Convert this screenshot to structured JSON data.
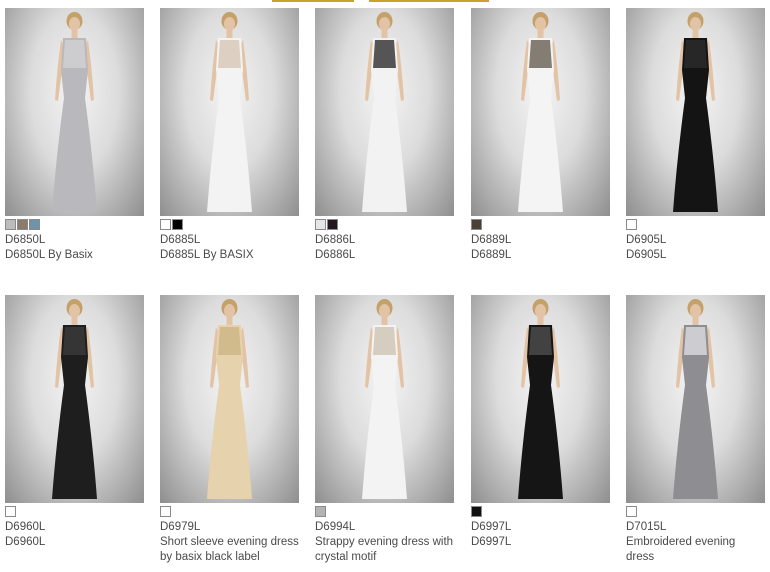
{
  "products": [
    {
      "code": "D6850L",
      "name": "D6850L By Basix",
      "swatches": [
        "#bcbcbc",
        "#8b7b6b",
        "#6f93a8"
      ],
      "dress": "#b9b9bd",
      "accent": "#d0d0d4"
    },
    {
      "code": "D6885L",
      "name": "D6885L By BASIX",
      "swatches": [
        "#ffffff",
        "#000000"
      ],
      "dress": "#f3f3f3",
      "accent": "#d8c9b8"
    },
    {
      "code": "D6886L",
      "name": "D6886L",
      "swatches": [
        "#e6e6e6",
        "#241820"
      ],
      "dress": "#f2f2f2",
      "accent": "#3a3a3a"
    },
    {
      "code": "D6889L",
      "name": "D6889L",
      "swatches": [
        "#4a4036"
      ],
      "dress": "#f4f4f4",
      "accent": "#6e675c"
    },
    {
      "code": "D6905L",
      "name": "D6905L",
      "swatches": [
        "#ffffff"
      ],
      "dress": "#141414",
      "accent": "#2a2a2a"
    },
    {
      "code": "D6960L",
      "name": "D6960L",
      "swatches": [
        "#ffffff"
      ],
      "dress": "#1e1e1e",
      "accent": "#3a3a3a"
    },
    {
      "code": "D6979L",
      "name": "Short sleeve evening dress by basix black label",
      "swatches": [
        "#ffffff"
      ],
      "dress": "#e6d3ad",
      "accent": "#cdb585"
    },
    {
      "code": "D6994L",
      "name": "Strappy evening dress with crystal motif",
      "swatches": [
        "#b3b3b3"
      ],
      "dress": "#f3f3f3",
      "accent": "#cfc5b5"
    },
    {
      "code": "D6997L",
      "name": "D6997L",
      "swatches": [
        "#111111"
      ],
      "dress": "#151515",
      "accent": "#4a4a4a"
    },
    {
      "code": "D7015L",
      "name": "Embroidered evening dress",
      "swatches": [
        "#ffffff"
      ],
      "dress": "#8d8d92",
      "accent": "#d8d8dc"
    }
  ]
}
